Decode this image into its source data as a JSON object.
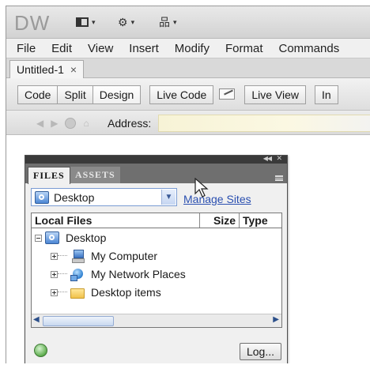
{
  "app": {
    "logo": "DW"
  },
  "toolbar_icons": [
    {
      "name": "layout-icon",
      "caret": "▾"
    },
    {
      "name": "gear-icon",
      "glyph": "⚙",
      "caret": "▾"
    },
    {
      "name": "site-icon",
      "glyph": "品",
      "caret": "▾"
    }
  ],
  "menu": [
    "File",
    "Edit",
    "View",
    "Insert",
    "Modify",
    "Format",
    "Commands"
  ],
  "document_tab": {
    "label": "Untitled-1",
    "close": "×"
  },
  "view_buttons": {
    "code": "Code",
    "split": "Split",
    "design": "Design",
    "live_code": "Live Code",
    "live_view": "Live View",
    "inspect_partial": "In"
  },
  "address": {
    "label": "Address:",
    "value": ""
  },
  "files_panel": {
    "tabs": [
      "FILES",
      "ASSETS"
    ],
    "active_tab": "FILES",
    "site_select": "Desktop",
    "manage_sites": "Manage Sites",
    "columns": [
      "Local Files",
      "Size",
      "Type"
    ],
    "tree": {
      "root": "Desktop",
      "items": [
        "My Computer",
        "My Network Places",
        "Desktop items"
      ]
    },
    "log_button": "Log..."
  }
}
